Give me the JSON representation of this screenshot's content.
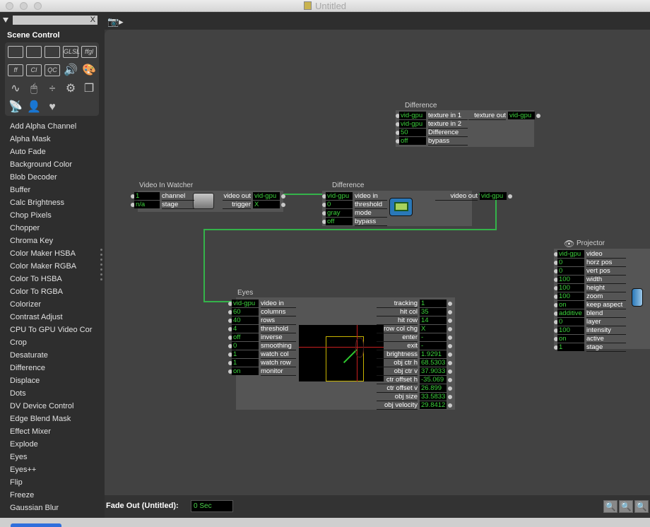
{
  "window": {
    "title": "Untitled"
  },
  "sidebar": {
    "search_value": "X",
    "section_title": "Scene Control",
    "palette_icons": [
      {
        "name": "scene-icon",
        "label": ""
      },
      {
        "name": "jump-icon",
        "label": ""
      },
      {
        "name": "jump-next-icon",
        "label": ""
      },
      {
        "name": "glsl-icon",
        "label": "GLSL"
      },
      {
        "name": "ffgl-icon",
        "label": "ffgl"
      },
      {
        "name": "freeframe-icon",
        "label": "ff"
      },
      {
        "name": "core-image-icon",
        "label": "CI"
      },
      {
        "name": "quartz-composer-icon",
        "label": "QC"
      },
      {
        "name": "sound-icon",
        "label": "🔊"
      },
      {
        "name": "palette-icon",
        "label": "🎨"
      },
      {
        "name": "wave-icon",
        "label": "∿"
      },
      {
        "name": "mouse-icon",
        "label": "🖱"
      },
      {
        "name": "math-icon",
        "label": "÷"
      },
      {
        "name": "gear-icon",
        "label": "⚙"
      },
      {
        "name": "layers-icon",
        "label": "❐"
      },
      {
        "name": "broadcast-icon",
        "label": "📡"
      },
      {
        "name": "user-icon",
        "label": "👤"
      },
      {
        "name": "heart-icon",
        "label": "♥"
      }
    ],
    "modules": [
      "Add Alpha Channel",
      "Alpha Mask",
      "Auto Fade",
      "Background Color",
      "Blob Decoder",
      "Buffer",
      "Calc Brightness",
      "Chop Pixels",
      "Chopper",
      "Chroma Key",
      "Color Maker HSBA",
      "Color Maker RGBA",
      "Color To HSBA",
      "Color To RGBA",
      "Colorizer",
      "Contrast Adjust",
      "CPU To GPU Video Cor",
      "Crop",
      "Desaturate",
      "Difference",
      "Displace",
      "Dots",
      "DV Device Control",
      "Edge Blend Mask",
      "Effect Mixer",
      "Explode",
      "Eyes",
      "Eyes++",
      "Flip",
      "Freeze",
      "Gaussian Blur"
    ]
  },
  "status": {
    "fade_label": "Fade Out (Untitled):",
    "fade_value": "0 Sec"
  },
  "actors": {
    "difference_top": {
      "title": "Difference",
      "inputs": [
        {
          "v": "vid-gpu",
          "l": "texture in 1"
        },
        {
          "v": "vid-gpu",
          "l": "texture in 2"
        },
        {
          "v": "50",
          "l": "Difference"
        },
        {
          "v": "off",
          "l": "bypass"
        }
      ],
      "outputs": [
        {
          "v": "vid-gpu",
          "l": "texture out"
        }
      ]
    },
    "video_in_watcher": {
      "title": "Video In Watcher",
      "inputs": [
        {
          "v": "1",
          "l": "channel"
        },
        {
          "v": "n/a",
          "l": "stage"
        }
      ],
      "outputs": [
        {
          "v": "vid-gpu",
          "l": "video out"
        },
        {
          "v": "X",
          "l": "trigger"
        }
      ]
    },
    "difference_mid": {
      "title": "Difference",
      "inputs": [
        {
          "v": "vid-gpu",
          "l": "video in"
        },
        {
          "v": "0",
          "l": "threshold"
        },
        {
          "v": "gray",
          "l": "mode"
        },
        {
          "v": "off",
          "l": "bypass"
        }
      ],
      "outputs": [
        {
          "v": "vid-gpu",
          "l": "video out"
        }
      ]
    },
    "eyes": {
      "title": "Eyes",
      "inputs": [
        {
          "v": "vid-gpu",
          "l": "video in"
        },
        {
          "v": "60",
          "l": "columns"
        },
        {
          "v": "40",
          "l": "rows"
        },
        {
          "v": "4",
          "l": "threshold"
        },
        {
          "v": "off",
          "l": "inverse"
        },
        {
          "v": "0",
          "l": "smoothing"
        },
        {
          "v": "1",
          "l": "watch col"
        },
        {
          "v": "1",
          "l": "watch row"
        },
        {
          "v": "on",
          "l": "monitor"
        }
      ],
      "outputs": [
        {
          "v": "1",
          "l": "tracking"
        },
        {
          "v": "35",
          "l": "hit col"
        },
        {
          "v": "14",
          "l": "hit row"
        },
        {
          "v": "X",
          "l": "row col chg"
        },
        {
          "v": "-",
          "l": "enter"
        },
        {
          "v": "-",
          "l": "exit"
        },
        {
          "v": "1.9291",
          "l": "brightness"
        },
        {
          "v": "68.5303",
          "l": "obj ctr h"
        },
        {
          "v": "37.9033",
          "l": "obj ctr v"
        },
        {
          "v": "-35.069",
          "l": "ctr offset h"
        },
        {
          "v": "26.899",
          "l": "ctr offset v"
        },
        {
          "v": "33.5833",
          "l": "obj size"
        },
        {
          "v": "29.8412",
          "l": "obj velocity"
        }
      ]
    },
    "projector": {
      "title": "Projector",
      "inputs": [
        {
          "v": "vid-gpu",
          "l": "video"
        },
        {
          "v": "0",
          "l": "horz pos"
        },
        {
          "v": "0",
          "l": "vert pos"
        },
        {
          "v": "100",
          "l": "width"
        },
        {
          "v": "100",
          "l": "height"
        },
        {
          "v": "100",
          "l": "zoom"
        },
        {
          "v": "on",
          "l": "keep aspect"
        },
        {
          "v": "additive",
          "l": "blend"
        },
        {
          "v": "0",
          "l": "layer"
        },
        {
          "v": "100",
          "l": "intensity"
        },
        {
          "v": "on",
          "l": "active"
        },
        {
          "v": "1",
          "l": "stage"
        }
      ]
    }
  }
}
